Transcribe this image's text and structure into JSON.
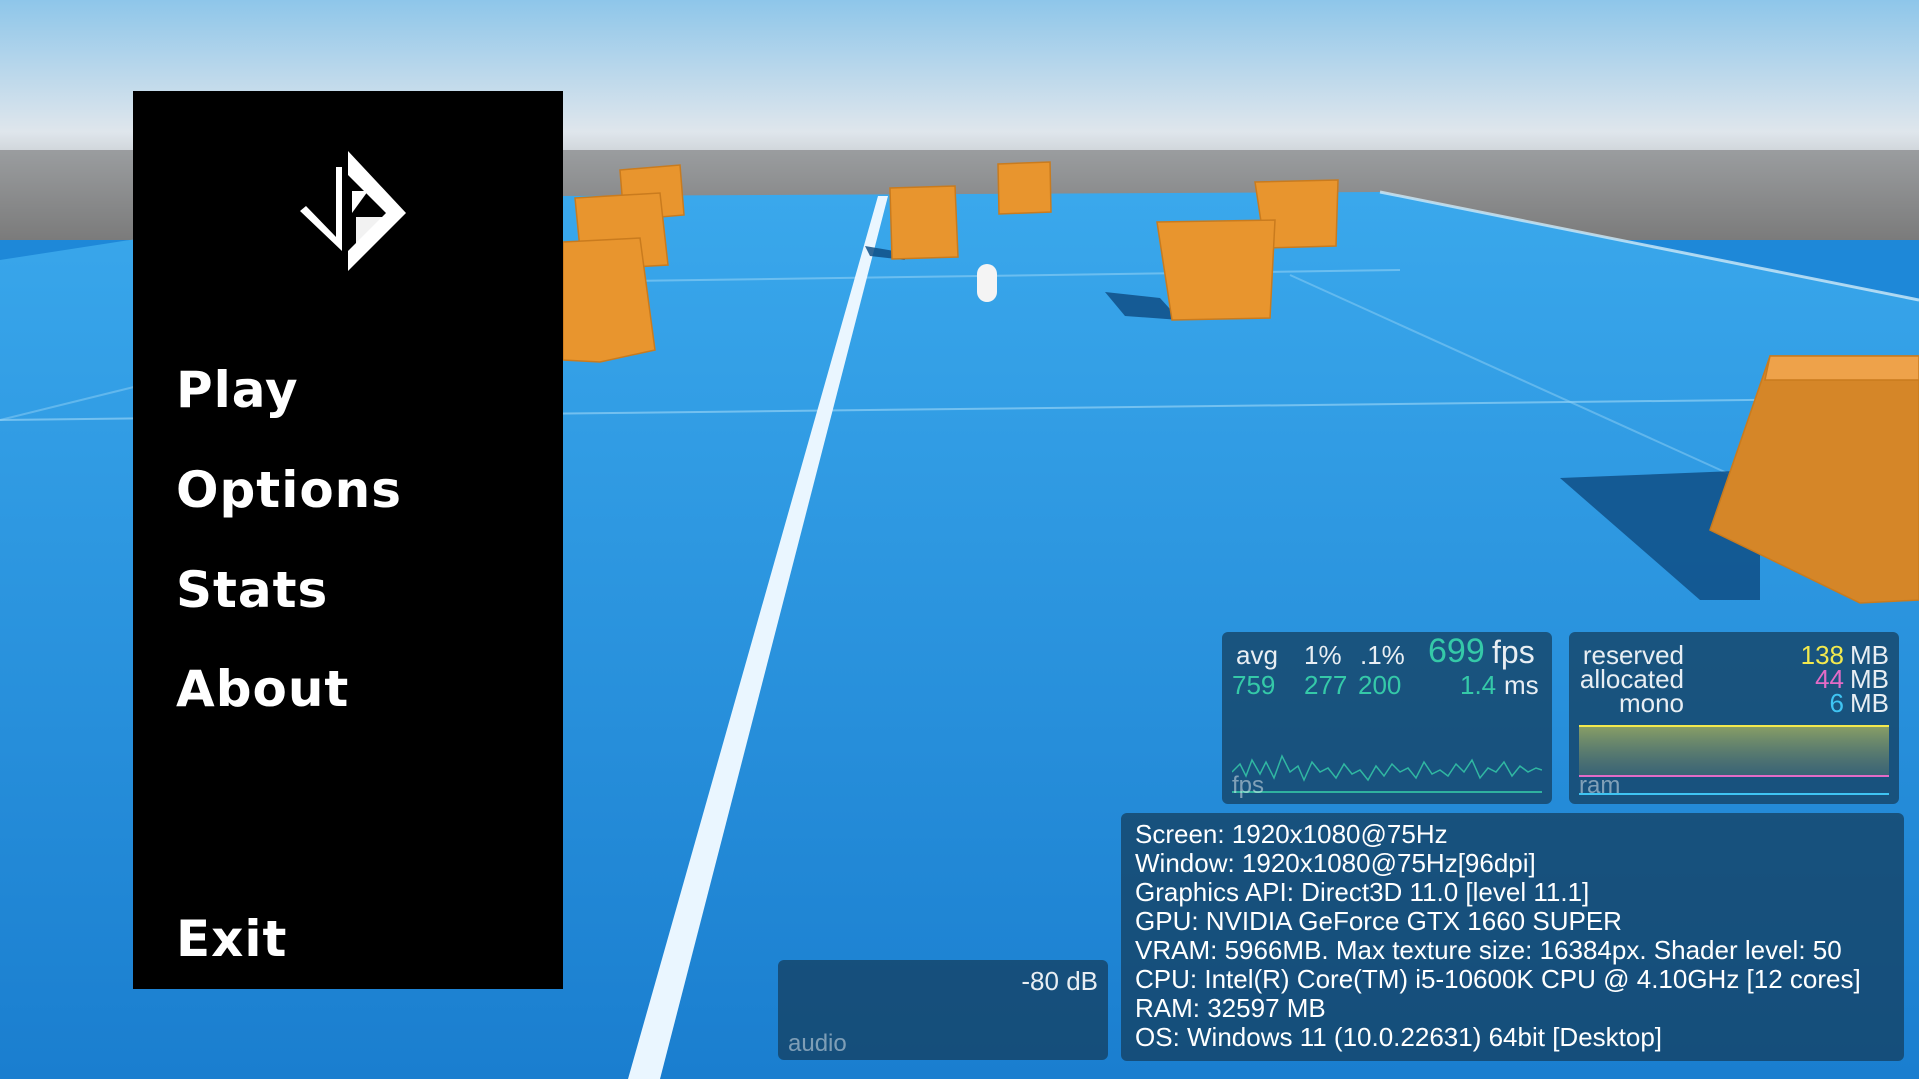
{
  "menu": {
    "items": [
      "Play",
      "Options",
      "Stats",
      "About"
    ],
    "exit_label": "Exit"
  },
  "fps_panel": {
    "col_avg": "avg",
    "col_1pct": "1%",
    "col_01pct": ".1%",
    "fps_value": "699",
    "fps_unit": "fps",
    "avg_value": "759",
    "low1_value": "277",
    "low01_value": "200",
    "ms_value": "1.4",
    "ms_unit": "ms",
    "graph_label": "fps"
  },
  "ram_panel": {
    "reserved_label": "reserved",
    "reserved_value": "138",
    "allocated_label": "allocated",
    "allocated_value": "44",
    "mono_label": "mono",
    "mono_value": "6",
    "unit": "MB",
    "graph_label": "ram",
    "colors": {
      "reserved": "#f2e94e",
      "allocated": "#e36bc6",
      "mono": "#3fc4f2"
    }
  },
  "audio_panel": {
    "level": "-80 dB",
    "graph_label": "audio"
  },
  "system_info": {
    "lines": [
      "Screen: 1920x1080@75Hz",
      "Window: 1920x1080@75Hz[96dpi]",
      "Graphics API: Direct3D 11.0 [level 11.1]",
      "GPU: NVIDIA GeForce GTX 1660 SUPER",
      "VRAM: 5966MB. Max texture size: 16384px. Shader level: 50",
      "CPU: Intel(R) Core(TM) i5-10600K CPU @ 4.10GHz [12 cores]",
      "RAM: 32597 MB",
      "OS: Windows 11  (10.0.22631) 64bit [Desktop]"
    ]
  },
  "colors": {
    "floor": "#1e88d8",
    "crate": "#e8952e",
    "menu_bg": "#000000",
    "fps_accent": "#35c9a8"
  }
}
